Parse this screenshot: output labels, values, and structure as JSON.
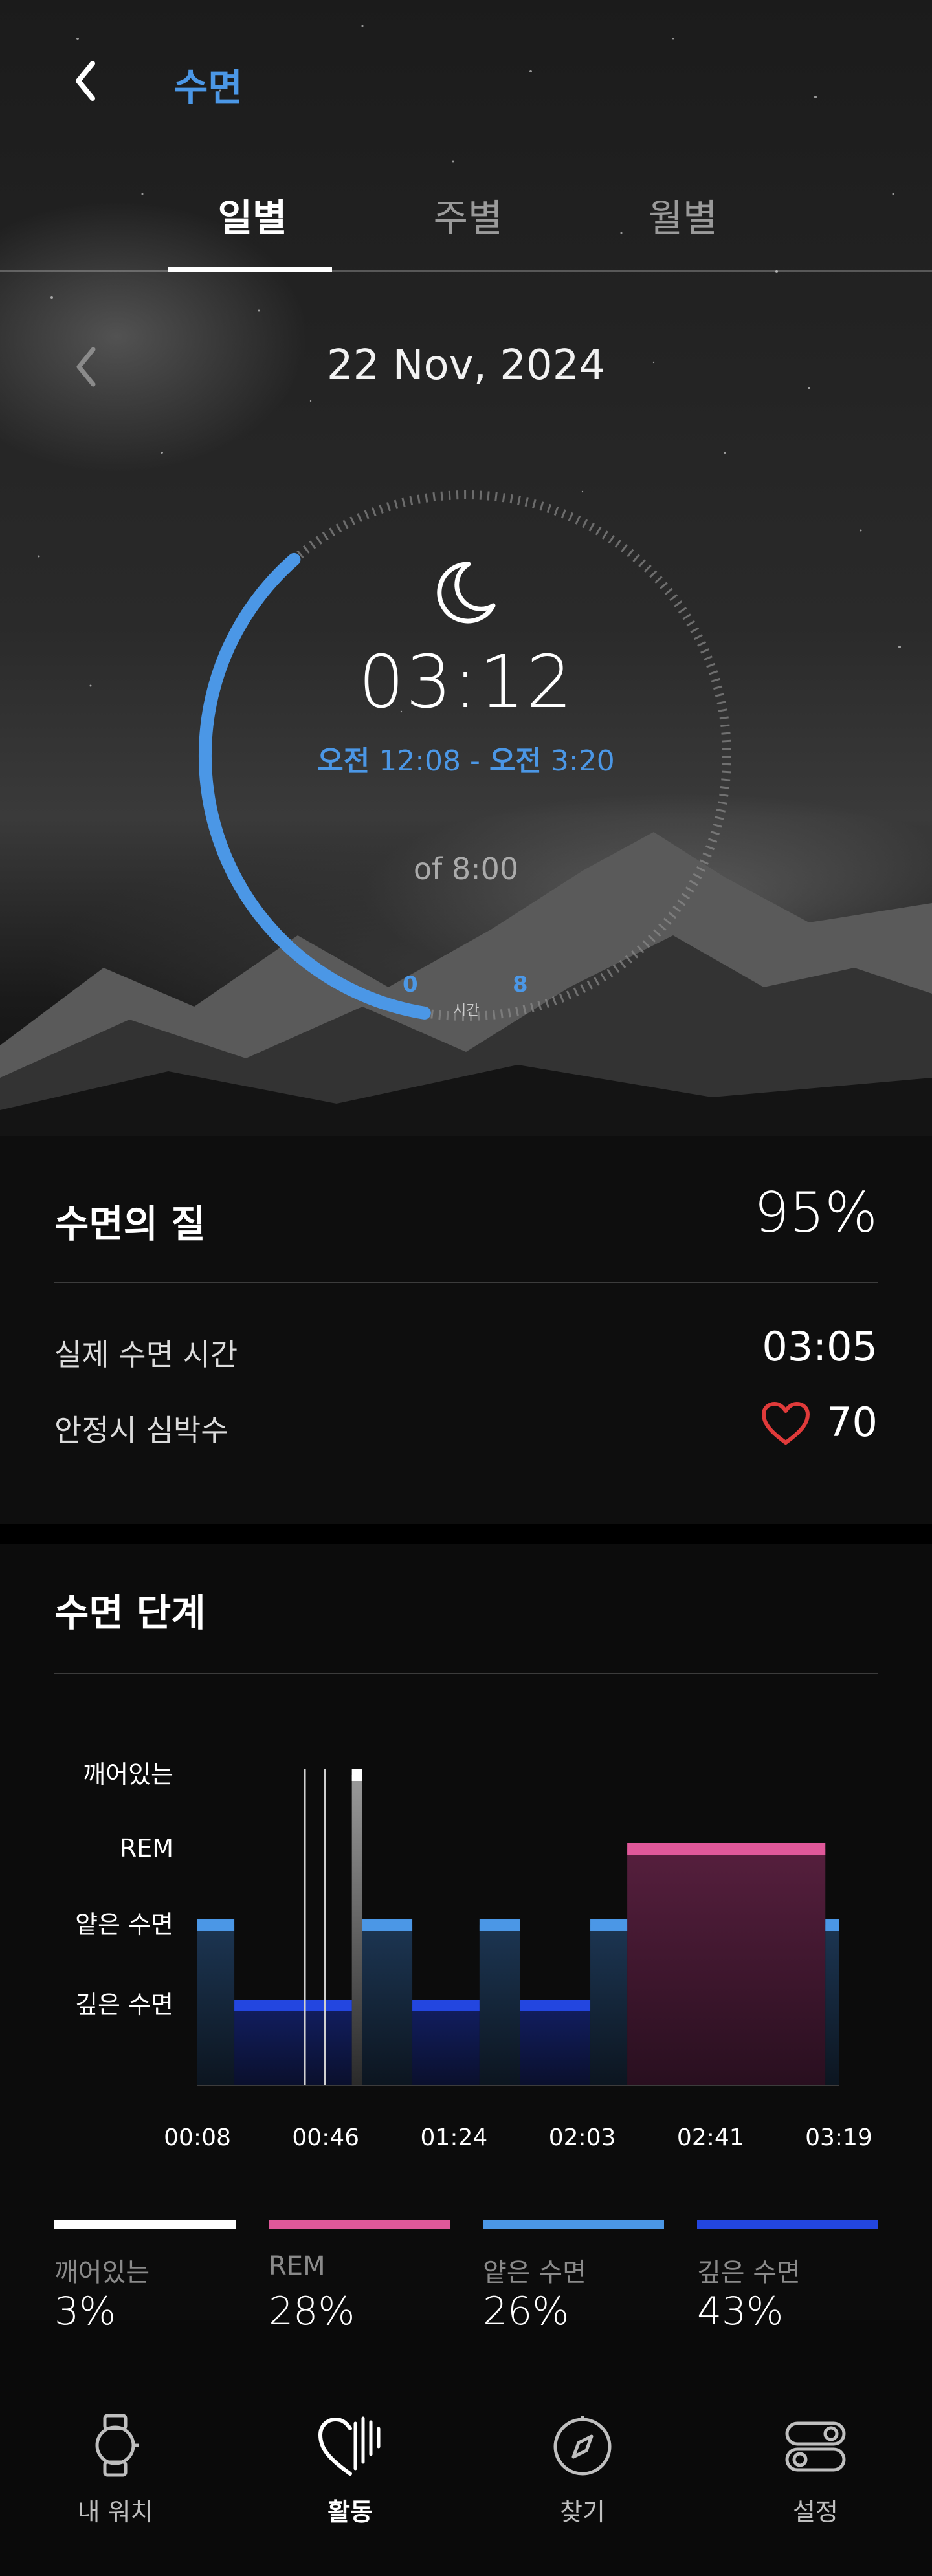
{
  "header": {
    "title": "수면"
  },
  "tabs": [
    {
      "label": "일별",
      "active": true
    },
    {
      "label": "주별",
      "active": false
    },
    {
      "label": "월별",
      "active": false
    }
  ],
  "date": "22 Nov, 2024",
  "summary": {
    "duration": "03:12",
    "start_ampm": "오전",
    "start_time": "12:08",
    "separator": "-",
    "end_ampm": "오전",
    "end_time": "3:20",
    "goal": "of 8:00",
    "scale_min": "0",
    "scale_max": "8",
    "scale_unit": "시간",
    "progress_fraction": 0.4
  },
  "quality": {
    "title": "수면의 질",
    "value": "95%",
    "rows": [
      {
        "label": "실제 수면 시간",
        "value": "03:05"
      },
      {
        "label": "안정시 심박수",
        "value": "70"
      }
    ]
  },
  "stages": {
    "title": "수면 단계",
    "legend": [
      {
        "label": "깨어있는",
        "pct": "3%",
        "color": "#ffffff"
      },
      {
        "label": "REM",
        "pct": "28%",
        "color": "#e0589a"
      },
      {
        "label": "얕은 수면",
        "pct": "26%",
        "color": "#4b97e6"
      },
      {
        "label": "깊은 수면",
        "pct": "43%",
        "color": "#2346e0"
      }
    ]
  },
  "chart_data": {
    "type": "area",
    "levels": [
      "깊은 수면",
      "얕은 수면",
      "REM",
      "깨어있는"
    ],
    "x_ticks": [
      "00:08",
      "00:46",
      "01:24",
      "02:03",
      "02:41",
      "03:19"
    ],
    "segments": [
      {
        "start": 8,
        "end": 19,
        "stage": "얕은 수면"
      },
      {
        "start": 19,
        "end": 54,
        "stage": "깊은 수면"
      },
      {
        "start": 54,
        "end": 57,
        "stage": "깨어있는"
      },
      {
        "start": 57,
        "end": 72,
        "stage": "얕은 수면"
      },
      {
        "start": 72,
        "end": 92,
        "stage": "깊은 수면"
      },
      {
        "start": 92,
        "end": 104,
        "stage": "얕은 수면"
      },
      {
        "start": 104,
        "end": 125,
        "stage": "깊은 수면"
      },
      {
        "start": 125,
        "end": 136,
        "stage": "얕은 수면"
      },
      {
        "start": 136,
        "end": 195,
        "stage": "REM"
      },
      {
        "start": 195,
        "end": 199,
        "stage": "얕은 수면"
      }
    ],
    "awake_spikes": [
      40,
      46
    ],
    "x_range": [
      8,
      199
    ]
  },
  "nav": [
    {
      "label": "내 워치",
      "icon": "watch-icon",
      "active": false
    },
    {
      "label": "활동",
      "icon": "heart-activity-icon",
      "active": true
    },
    {
      "label": "찾기",
      "icon": "compass-icon",
      "active": false
    },
    {
      "label": "설정",
      "icon": "toggle-settings-icon",
      "active": false
    }
  ],
  "colors": {
    "accent": "#4b97e6",
    "rem": "#e0589a",
    "deep": "#2346e0",
    "heart": "#e03a3a"
  }
}
